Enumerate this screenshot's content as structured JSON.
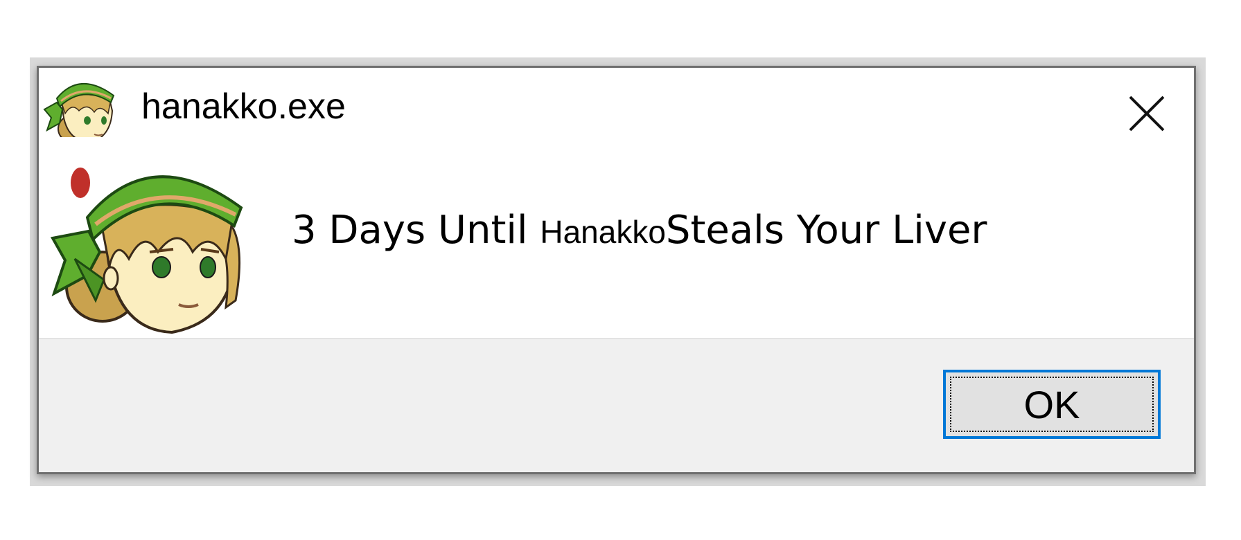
{
  "window": {
    "title": "hanakko.exe",
    "title_icon": "hanakko-avatar-icon"
  },
  "message": {
    "prefix": "3 Days Until ",
    "name": "Hanakko",
    "suffix": "Steals Your Liver",
    "icon": "hanakko-avatar"
  },
  "buttons": {
    "ok_label": "OK",
    "close_icon": "close-icon"
  },
  "colors": {
    "accent": "#0078d7",
    "footer_bg": "#f0f0f0",
    "button_bg": "#e1e1e1",
    "bandana": "#5fae2e",
    "hair": "#d8b25a",
    "skin": "#fbeec0"
  }
}
